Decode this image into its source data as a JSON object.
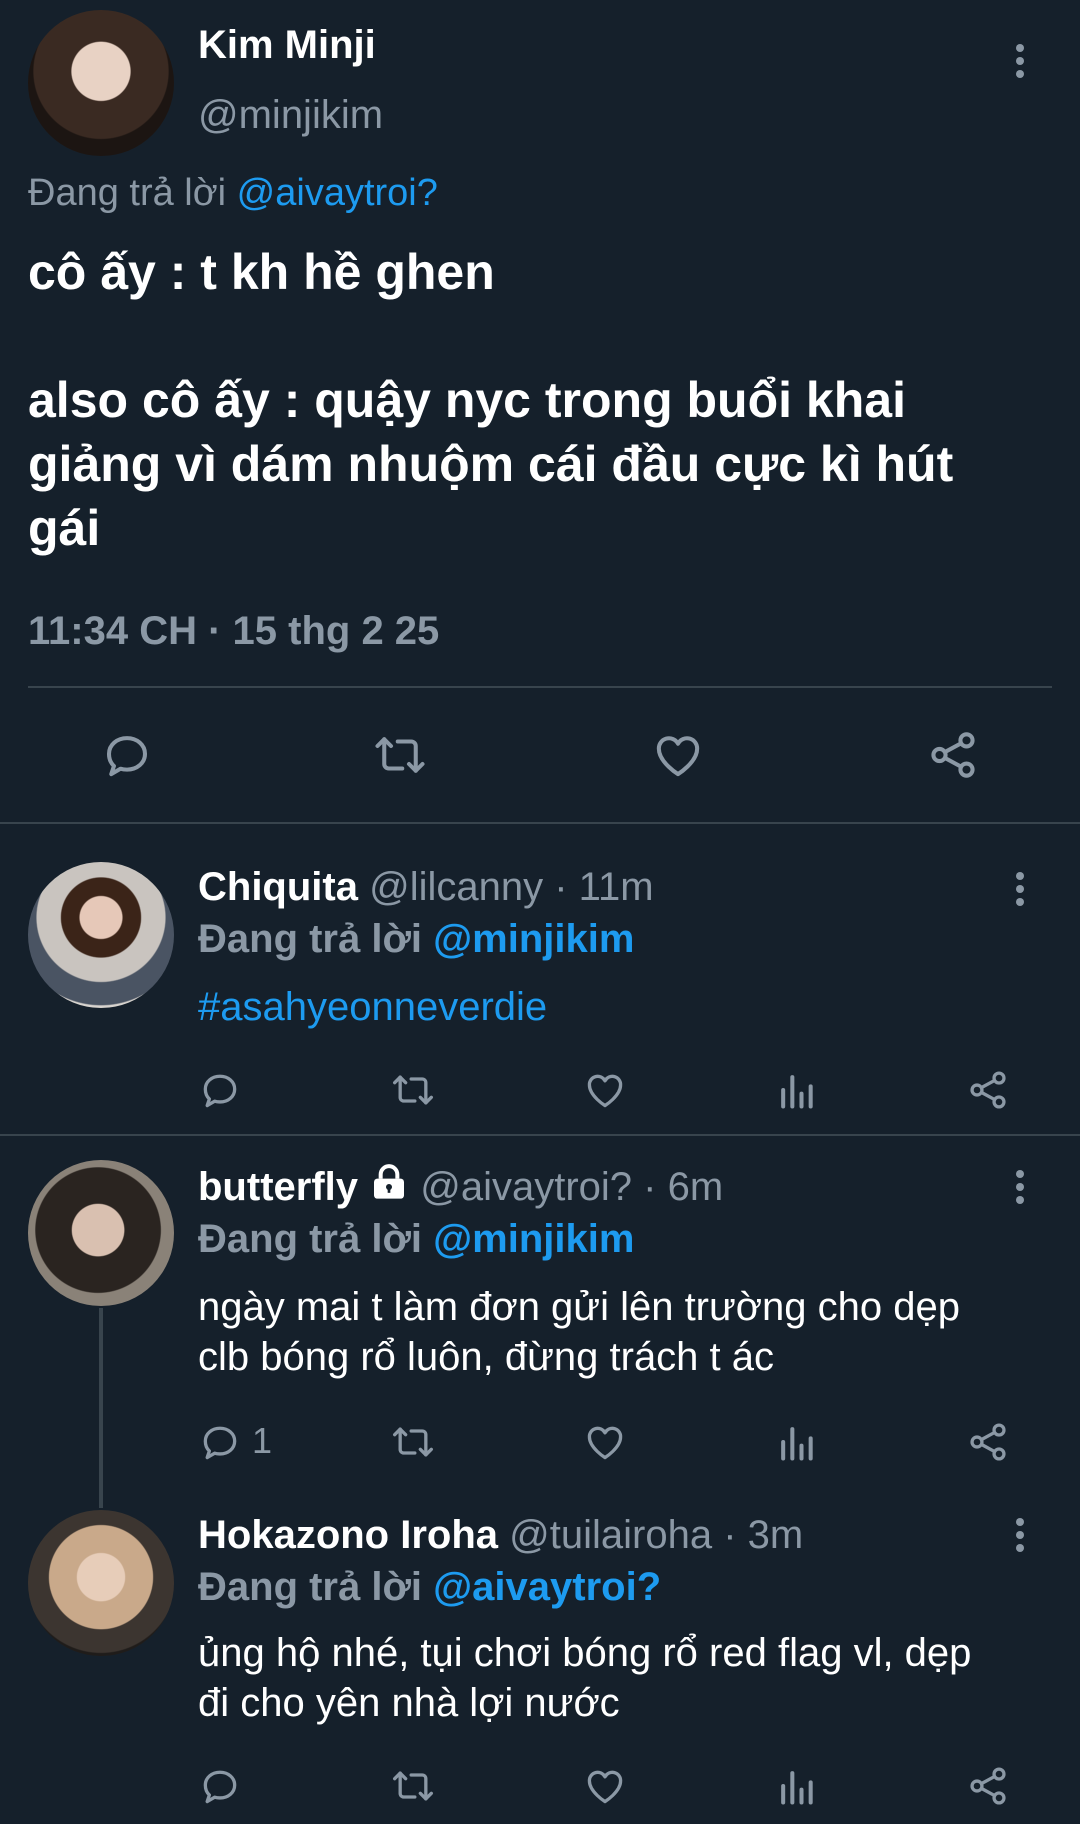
{
  "main_tweet": {
    "author_name": "Kim Minji",
    "author_handle": "@minjikim",
    "replying_prefix": "Đang trả lời",
    "replying_to": "@aivaytroi?",
    "text_line1": "cô ấy : t kh hề ghen",
    "text_line2": "also cô ấy : quậy nyc trong buổi khai",
    "text_line3": "giảng vì dám nhuộm cái đầu cực kì hút",
    "text_line4": "gái",
    "timestamp": "11:34 CH · 15 thg 2 25",
    "icons": [
      "reply-icon",
      "retweet-icon",
      "like-icon",
      "share-icon"
    ]
  },
  "replies": [
    {
      "name": "Chiquita",
      "handle": "@lilcanny",
      "time": "· 11m",
      "replying_prefix": "Đang trả lời",
      "replying_to": "@minjikim",
      "text_line1": "#asahyeonneverdie",
      "text_line2": "",
      "reply_count": ""
    },
    {
      "name": "butterfly",
      "handle": "@aivaytroi?",
      "time": "· 6m",
      "replying_prefix": "Đang trả lời",
      "replying_to": "@minjikim",
      "text_line1": "ngày mai t làm đơn gửi lên trường cho dẹp",
      "text_line2": "clb bóng rổ luôn, đừng trách t ác",
      "reply_count": "1",
      "locked": true
    },
    {
      "name": "Hokazono Iroha",
      "handle": "@tuilairoha",
      "time": "· 3m",
      "replying_prefix": "Đang trả lời",
      "replying_to": "@aivaytroi?",
      "text_line1": "ủng hộ nhé, tụi chơi bóng rổ red flag vl, dẹp",
      "text_line2": "đi cho yên nhà lợi nước",
      "reply_count": ""
    }
  ],
  "colors": {
    "background": "#15202b",
    "text": "#ffffff",
    "muted": "#8b98a5",
    "link": "#1d9bf0",
    "divider": "#38444d"
  }
}
